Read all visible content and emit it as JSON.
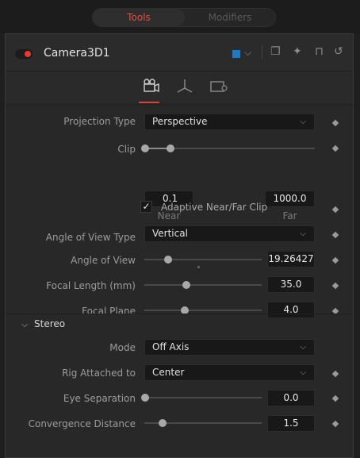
{
  "tabs": {
    "tools": "Tools",
    "modifiers": "Modifiers"
  },
  "header": {
    "tool_name": "Camera3D1",
    "color_swatch": "#1f7ac6"
  },
  "iconbar": {
    "icons": [
      "camera-tab-icon",
      "transform-tab-icon",
      "settings-tab-icon"
    ]
  },
  "controls": {
    "projection_type": {
      "label": "Projection Type",
      "value": "Perspective"
    },
    "clip": {
      "label": "Clip",
      "near": "0.1",
      "far": "1000.0",
      "near_label": "Near",
      "far_label": "Far"
    },
    "adaptive_clip": {
      "label": "Adaptive Near/Far Clip",
      "checked": true
    },
    "angle_of_view_type": {
      "label": "Angle of View Type",
      "value": "Vertical"
    },
    "angle_of_view": {
      "label": "Angle of View",
      "value": "19.26427"
    },
    "focal_length": {
      "label": "Focal Length (mm)",
      "value": "35.0"
    },
    "focal_plane": {
      "label": "Focal Plane",
      "value": "4.0"
    }
  },
  "stereo": {
    "title": "Stereo",
    "mode": {
      "label": "Mode",
      "value": "Off Axis"
    },
    "rig_attached_to": {
      "label": "Rig Attached to",
      "value": "Center"
    },
    "eye_separation": {
      "label": "Eye Separation",
      "value": "0.0"
    },
    "convergence_distance": {
      "label": "Convergence Distance",
      "value": "1.5"
    }
  },
  "colors": {
    "accent": "#e64b3c",
    "toggle_on": "#e63a2e"
  }
}
